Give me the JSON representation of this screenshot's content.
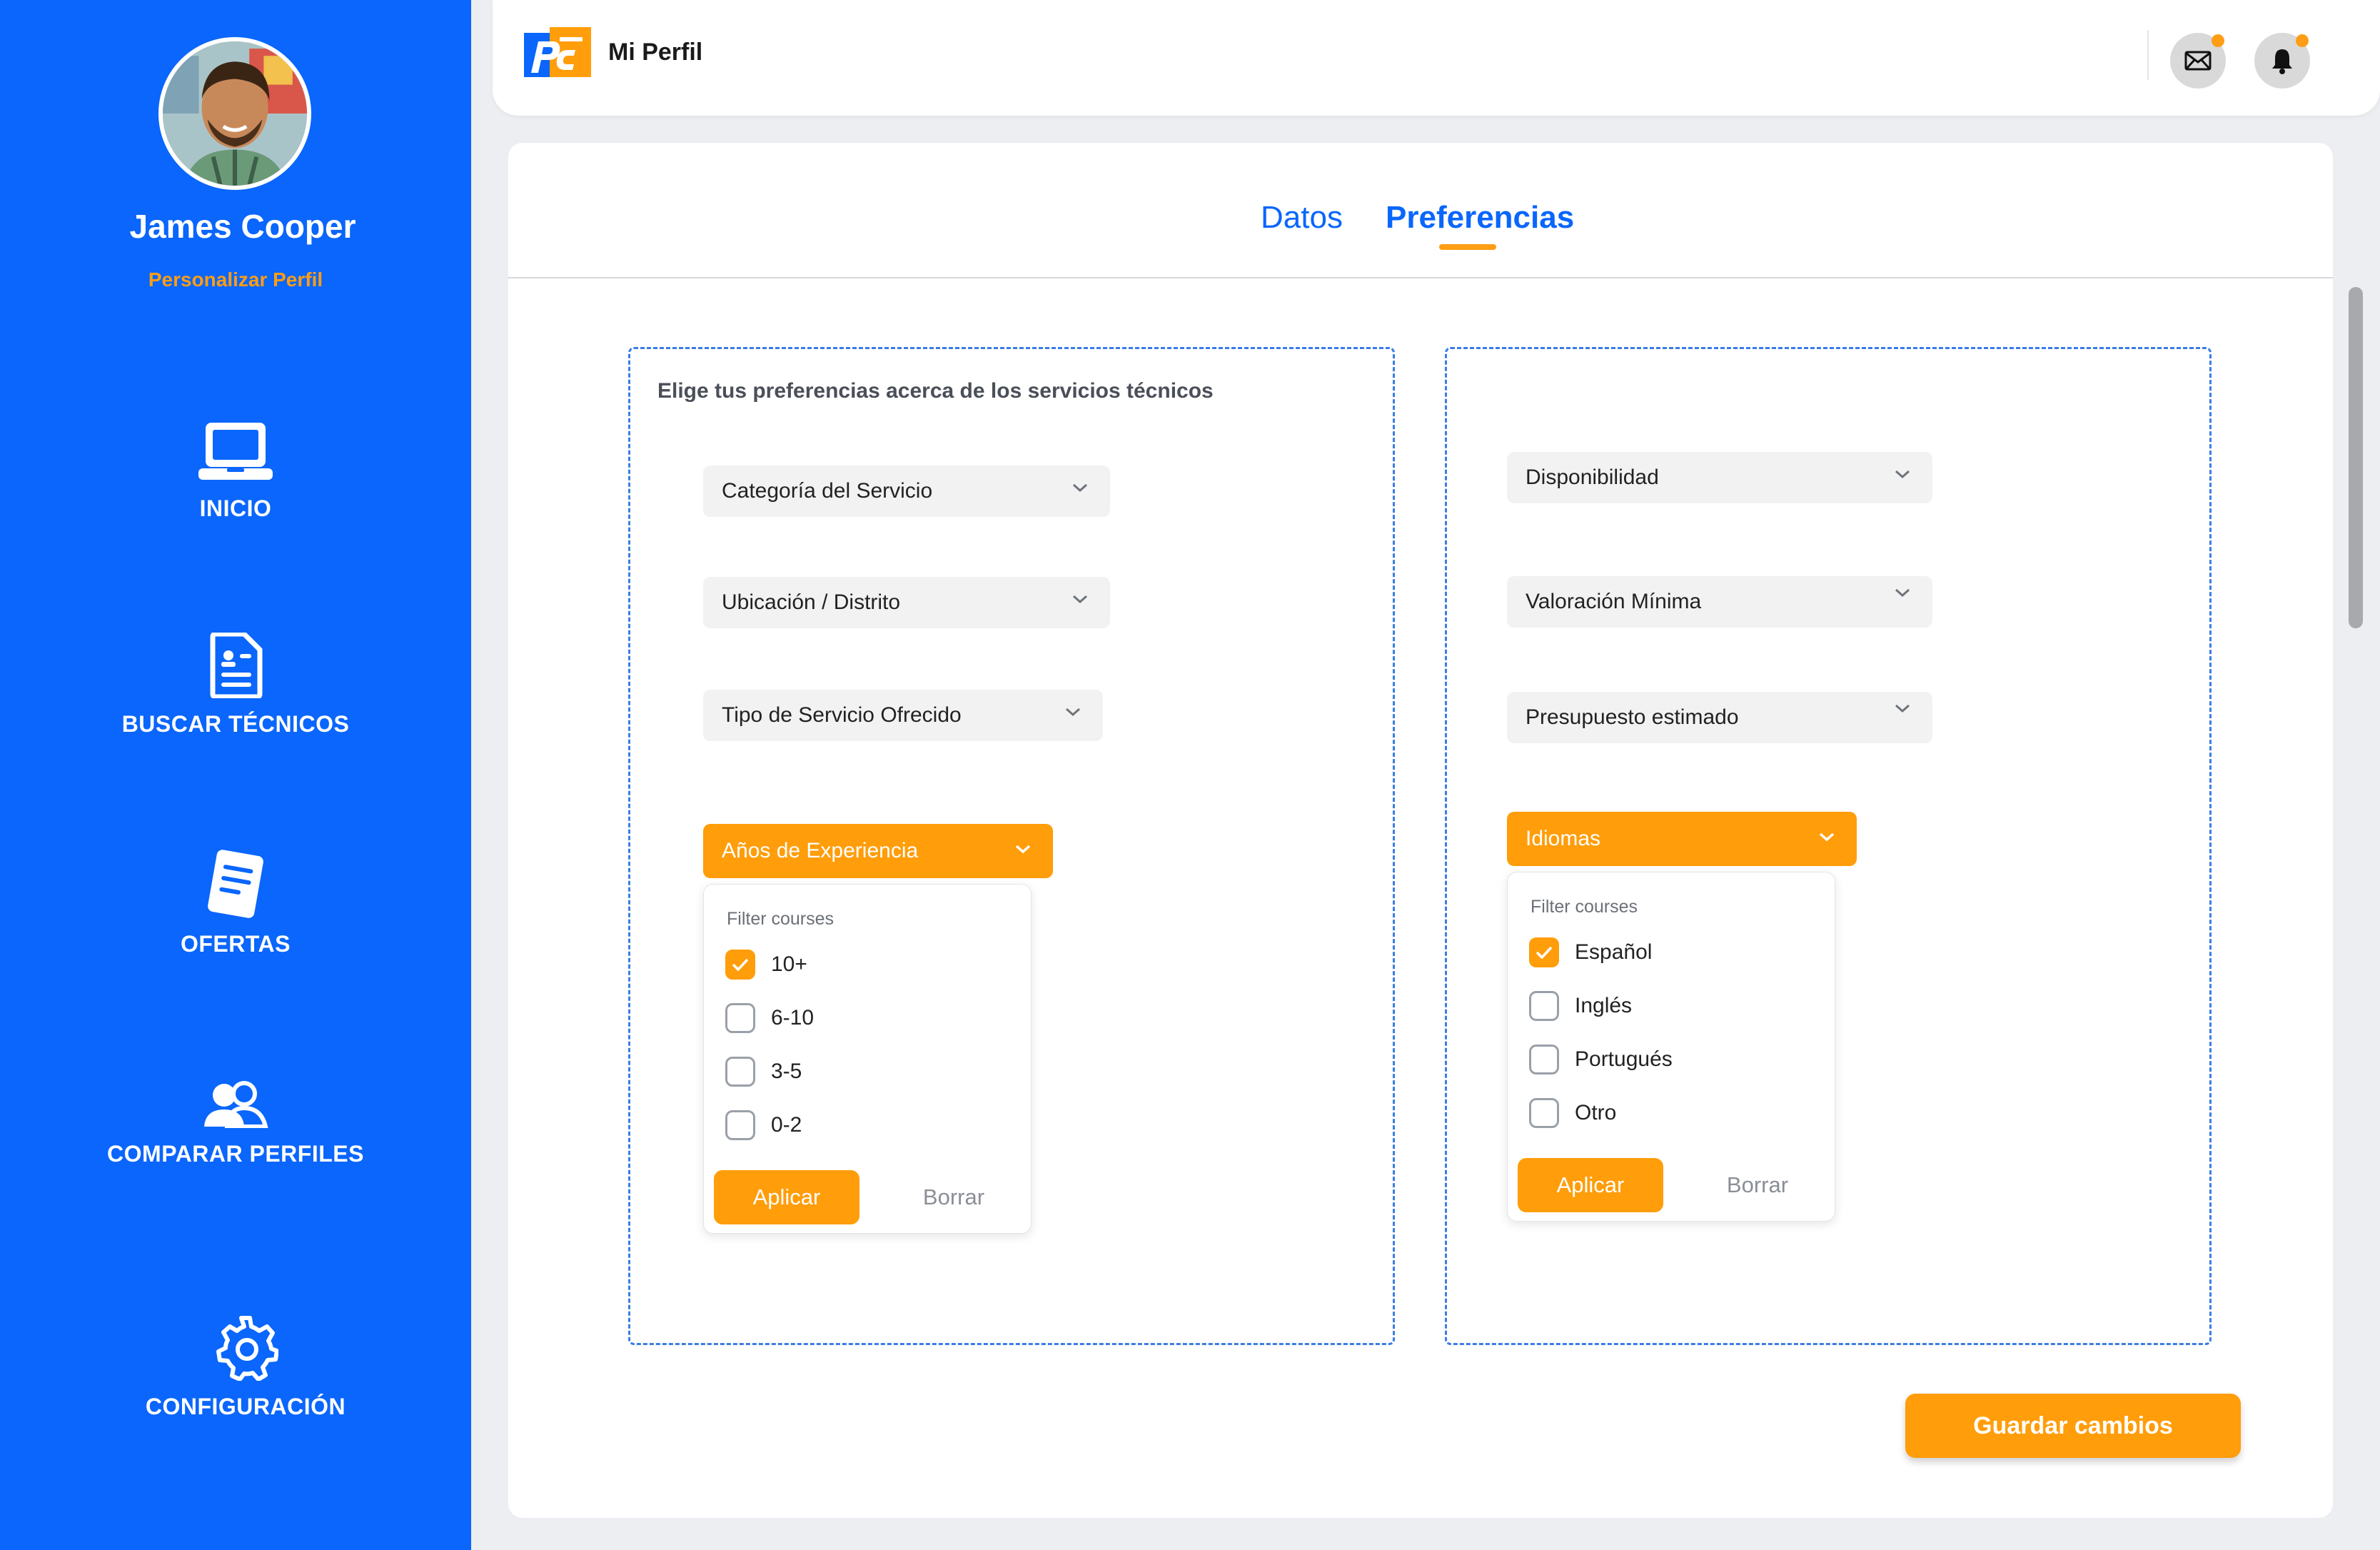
{
  "sidebar": {
    "user_name": "James Cooper",
    "personalize_label": "Personalizar Perfil",
    "items": [
      {
        "label": "INICIO",
        "icon": "laptop-icon"
      },
      {
        "label": "BUSCAR TÉCNICOS",
        "icon": "document-icon"
      },
      {
        "label": "OFERTAS",
        "icon": "note-icon"
      },
      {
        "label": "COMPARAR PERFILES",
        "icon": "users-icon"
      },
      {
        "label": "CONFIGURACIÓN",
        "icon": "gear-icon"
      }
    ]
  },
  "header": {
    "title": "Mi Perfil",
    "icons": [
      "mail-icon",
      "bell-icon"
    ]
  },
  "tabs": [
    {
      "label": "Datos",
      "active": false
    },
    {
      "label": "Preferencias",
      "active": true
    }
  ],
  "left_panel": {
    "title": "Elige tus preferencias acerca de los servicios técnicos",
    "selects": [
      "Categoría del Servicio",
      "Ubicación / Distrito",
      "Tipo de Servicio Ofrecido"
    ],
    "open_select": {
      "label": "Años de Experiencia",
      "filter_placeholder": "Filter courses",
      "options": [
        {
          "label": "10+",
          "checked": true
        },
        {
          "label": "6-10",
          "checked": false
        },
        {
          "label": "3-5",
          "checked": false
        },
        {
          "label": "0-2",
          "checked": false
        }
      ],
      "apply_label": "Aplicar",
      "clear_label": "Borrar"
    }
  },
  "right_panel": {
    "selects": [
      "Disponibilidad",
      "Valoración Mínima",
      "Presupuesto estimado"
    ],
    "open_select": {
      "label": "Idiomas",
      "filter_placeholder": "Filter courses",
      "options": [
        {
          "label": "Español",
          "checked": true
        },
        {
          "label": "Inglés",
          "checked": false
        },
        {
          "label": "Portugués",
          "checked": false
        },
        {
          "label": "Otro",
          "checked": false
        }
      ],
      "apply_label": "Aplicar",
      "clear_label": "Borrar"
    }
  },
  "save_label": "Guardar cambios",
  "colors": {
    "primary": "#0a66fc",
    "accent": "#ff9d0a",
    "background": "#eceef1"
  }
}
